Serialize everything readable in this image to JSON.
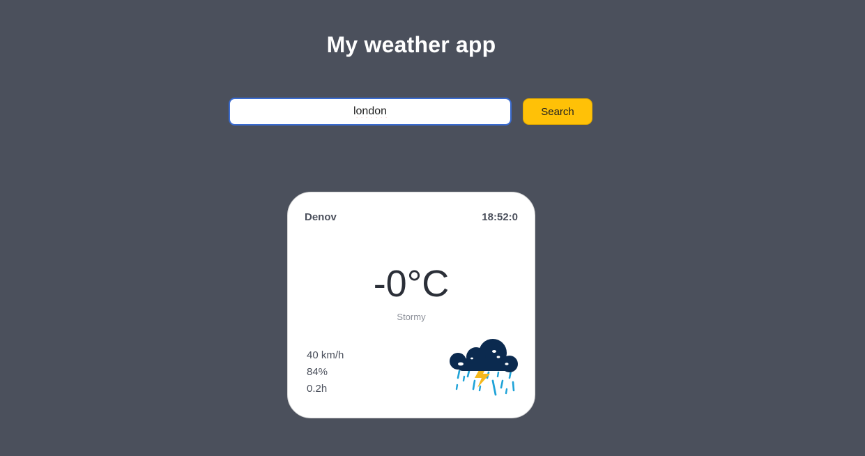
{
  "header": {
    "title": "My weather app"
  },
  "search": {
    "value": "london",
    "button_label": "Search"
  },
  "card": {
    "city": "Denov",
    "time": "18:52:0",
    "temperature": "-0°C",
    "condition": "Stormy",
    "wind": "40 km/h",
    "humidity": "84%",
    "precipitation": "0.2h",
    "icon": "storm-cloud-icon"
  },
  "colors": {
    "background": "#4b505c",
    "button": "#ffc107",
    "input_border": "#3a6bd0",
    "card": "#ffffff",
    "cloud": "#0b2a4f",
    "lightning": "#f5b81c",
    "rain": "#1fa3d8"
  }
}
